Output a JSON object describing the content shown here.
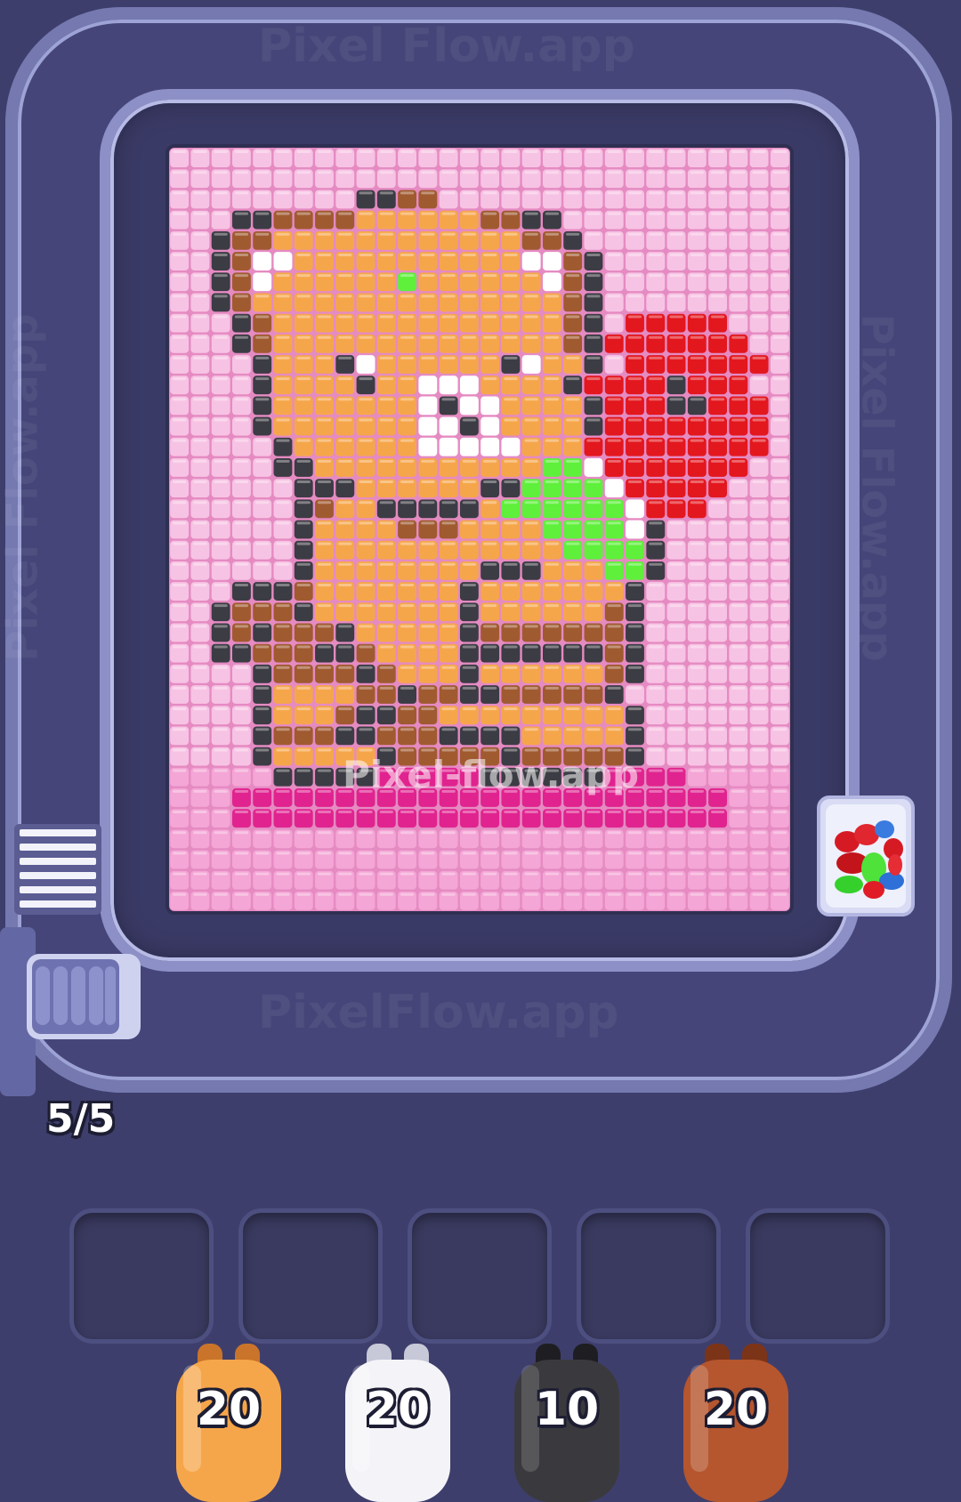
{
  "game": {
    "watermark_top": "Pixel Flow.app",
    "watermark_bottom": "PixelFlow.app",
    "watermark_side": "Pixel Flow.app",
    "watermark_center": "Pixel-flow.app",
    "capacity_counter": "5/5"
  },
  "queue_slots": 5,
  "shooters": [
    {
      "count": "20",
      "color": "#f6a64a",
      "dark": "#c9742a",
      "name": "orange"
    },
    {
      "count": "20",
      "color": "#f4f4f8",
      "dark": "#c7c8d8",
      "name": "white"
    },
    {
      "count": "10",
      "color": "#3a3a3e",
      "dark": "#1e1e22",
      "name": "black"
    },
    {
      "count": "20",
      "color": "#b5562e",
      "dark": "#7c3418",
      "name": "brown"
    }
  ],
  "colors": {
    "pink_bg": "#f4a6d6",
    "light_pink": "#f7c3e4",
    "magenta": "#e0238f",
    "orange": "#f6a64a",
    "brown": "#a05a30",
    "dark": "#3c3c44",
    "white": "#ffffff",
    "red": "#e3171e",
    "green": "#5ef03a",
    "belt": "#454579",
    "background": "#3e3e6c"
  },
  "pixel_art": {
    "cols": 30,
    "rows": 37,
    "legend": {
      ".": "light_pink",
      "p": "pink_bg",
      "m": "magenta",
      "o": "orange",
      "b": "brown",
      "k": "dark",
      "w": "white",
      "r": "red",
      "g": "green"
    },
    "rows_data": [
      "..............................",
      "..............................",
      ".........kkbb..........",
      "...kkbbbboooooobbkk...........",
      "..kbboooooooooooobbk..........",
      "..kbwwooooooooooowwbk.........",
      "..kbwoooooogoooooowbk.........",
      "..kbooooooooooooooobk.........",
      "...kboooooooooooooobk.rrrrr...",
      "...kboooooooooooooobkrrrrrrr..",
      "....koookwooooookwook.rrrrrrr.",
      "....kooookoowwwooookrrrrkrrr..",
      "....kooooooowkwwooookrrrkkrrr.",
      "....kooooooowwkwooookrrrrrrrr.",
      ".....koooooowwwwwooorrrrrrrrr.",
      ".....kkoooooooooooggwrrrrrrr..",
      "......kkkooooookkggggwrrrrr...",
      "......kbookkkkkoggggggwrrr....",
      "......koooobbbooooggggwk......",
      "......kooooooooooooggggk......",
      "......kooooooookkkoooggk......",
      "...kkkboooooookoooooook.......",
      "..kbbbkoooooookoooooobk.......",
      "..kbkbbbkoooookbbbbbbbk.......",
      "..kkbbbkkbooookkkkkkkbk.......",
      "....kbbbbkboookoooooobk.......",
      "....koooobbkbbkkbbbbbk........",
      "....kooobkkbboooooooook.......",
      "....kbbbkkbbbkkkkoooook.......",
      "....koooookbbbbbkbbbbbk.......",
      ".....kkkkkmmmmmkkkkkkmmmm.....",
      "...mmmmmmmmmmmmmmmmmmmmmmmm...",
      "...mmmmmmmmmmmmmmmmmmmmmmmm...",
      "..............................",
      "..............................",
      "..............................",
      ".............................."
    ]
  }
}
